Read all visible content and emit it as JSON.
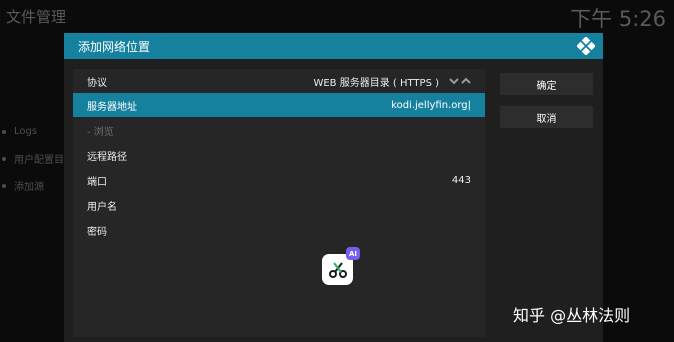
{
  "background": {
    "title": "文件管理",
    "clock": "下午 5:26",
    "items": [
      {
        "label": "Logs"
      },
      {
        "label": "用户配置目"
      },
      {
        "label": "添加源"
      }
    ]
  },
  "dialog": {
    "title": "添加网络位置",
    "logo_icon": "kodi-logo-icon",
    "rows": [
      {
        "label": "协议",
        "value": "WEB 服务器目录 ( HTTPS )"
      },
      {
        "label": "服务器地址",
        "value": "kodi.jellyfin.org|"
      },
      {
        "label": "- 浏览",
        "value": ""
      },
      {
        "label": "远程路径",
        "value": ""
      },
      {
        "label": "端口",
        "value": "443"
      },
      {
        "label": "用户名",
        "value": ""
      },
      {
        "label": "密码",
        "value": ""
      }
    ],
    "buttons": {
      "ok": "确定",
      "cancel": "取消"
    }
  },
  "overlay": {
    "ai_badge": "AI",
    "app_icon": "scissors-icon"
  },
  "watermark": "知乎 @丛林法则",
  "colors": {
    "accent": "#16819f",
    "dialog_bg": "#1f1f1f",
    "panel_bg": "#262626"
  }
}
